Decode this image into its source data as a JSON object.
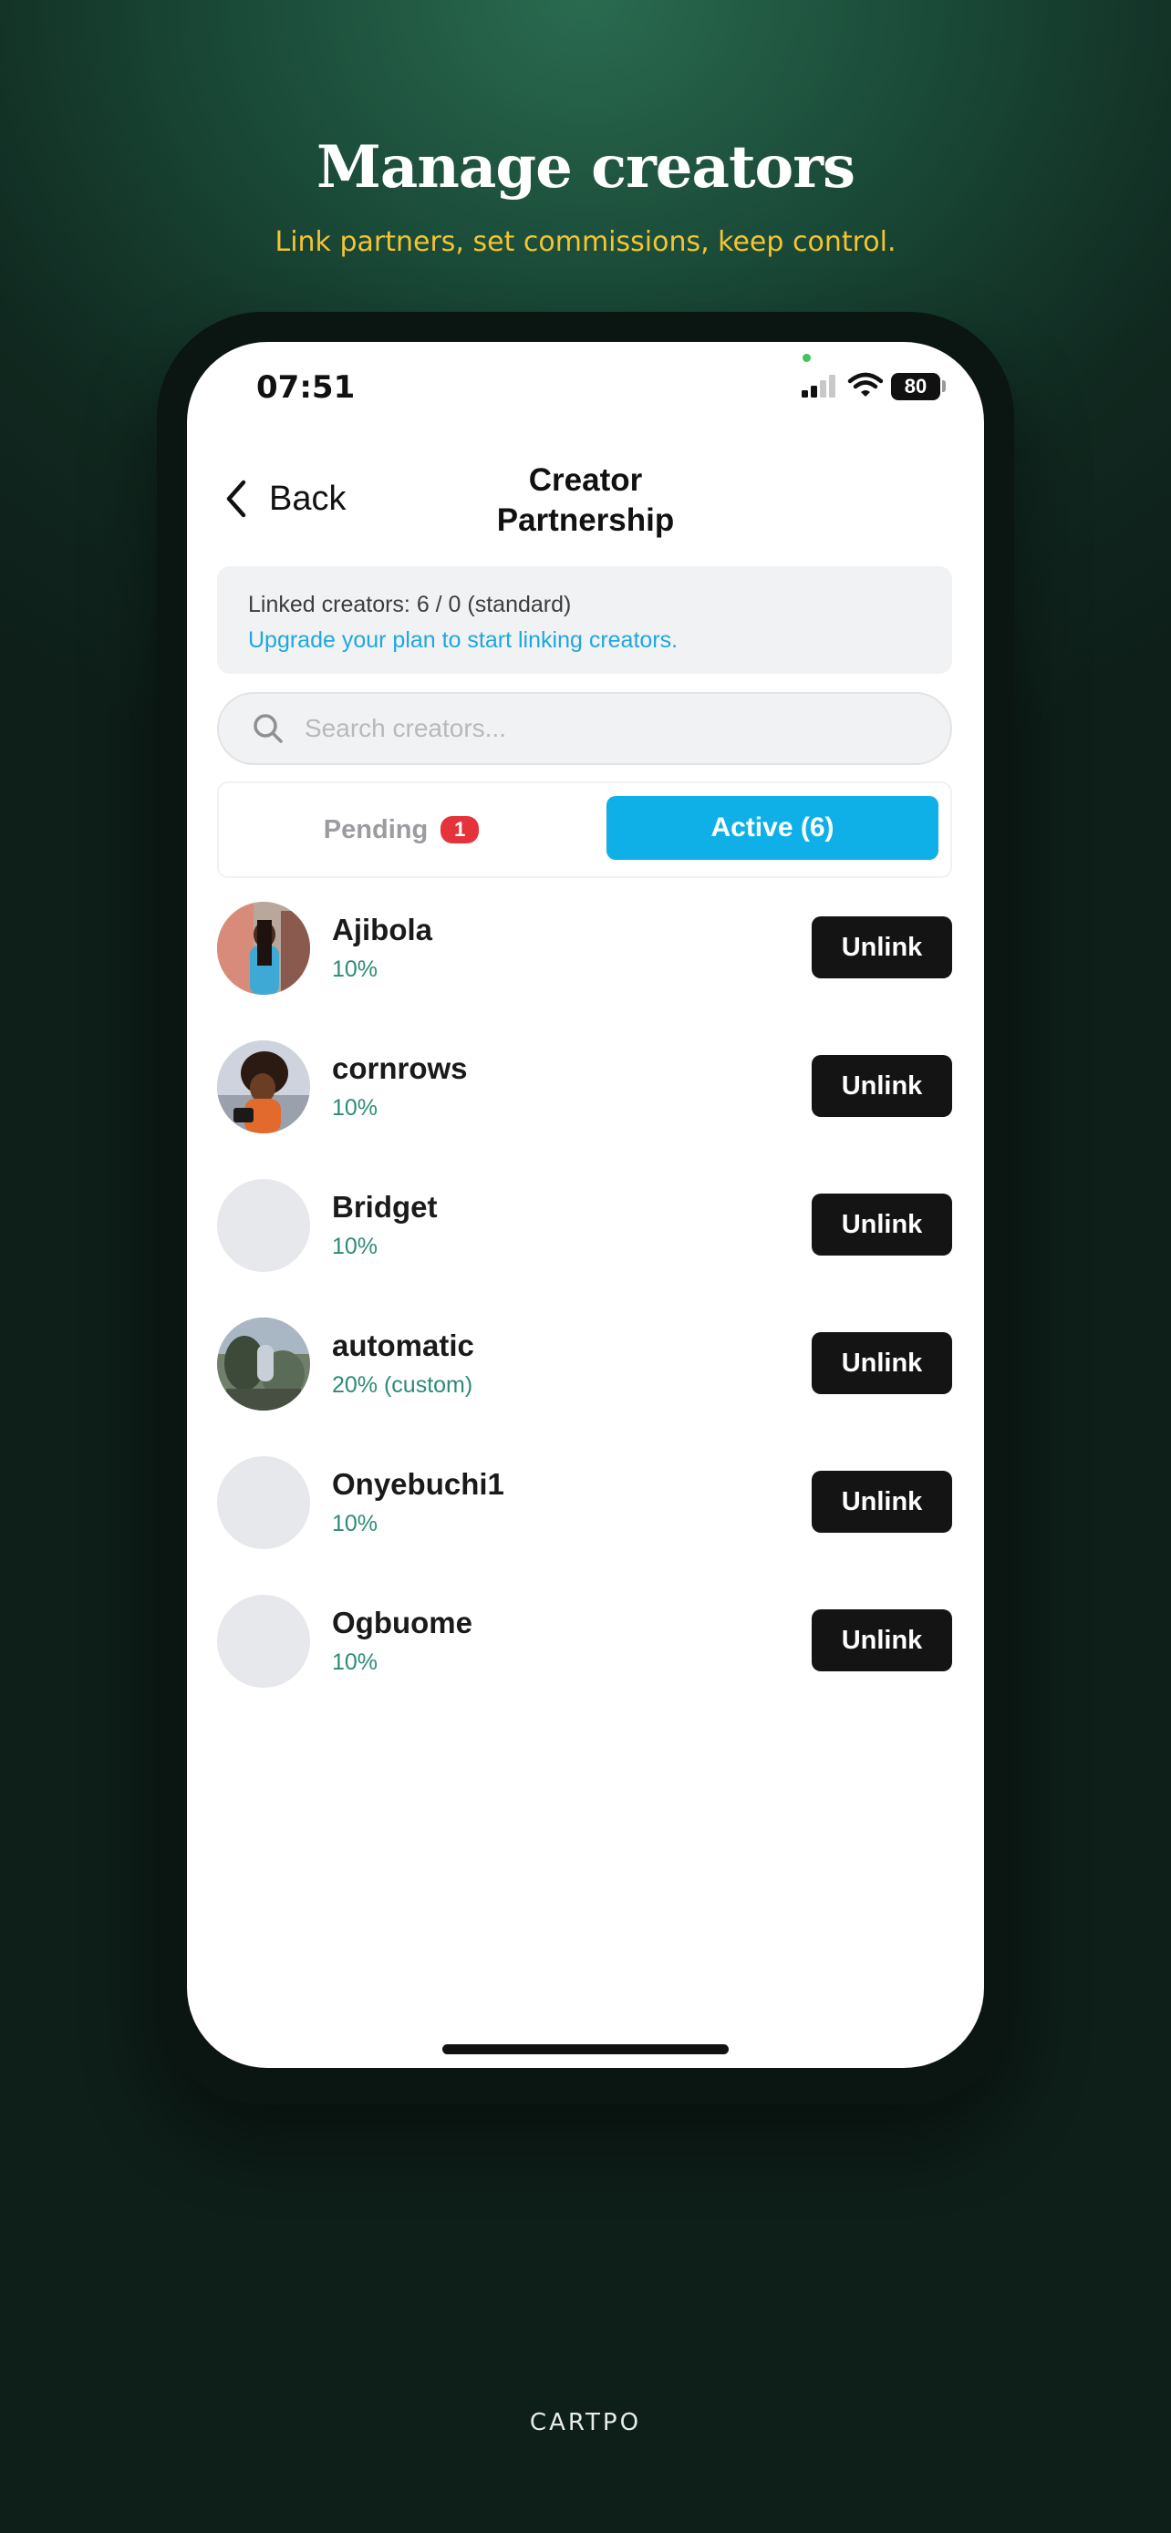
{
  "marketing": {
    "headline": "Manage creators",
    "subline": "Link partners, set commissions, keep control.",
    "brand": "CARTPO"
  },
  "status_bar": {
    "time": "07:51",
    "battery": "80"
  },
  "nav": {
    "back_label": "Back",
    "title": "Creator\nPartnership"
  },
  "info": {
    "linked_text": "Linked creators: 6 / 0 (standard)",
    "upgrade_text": "Upgrade your plan to start linking creators."
  },
  "search": {
    "placeholder": "Search creators..."
  },
  "tabs": {
    "pending_label": "Pending",
    "pending_count": "1",
    "active_label": "Active (6)"
  },
  "creators": [
    {
      "name": "Ajibola",
      "rate": "10%",
      "action": "Unlink",
      "avatar": "photo"
    },
    {
      "name": "cornrows",
      "rate": "10%",
      "action": "Unlink",
      "avatar": "photo"
    },
    {
      "name": "Bridget",
      "rate": "10%",
      "action": "Unlink",
      "avatar": "placeholder"
    },
    {
      "name": "automatic",
      "rate": "20% (custom)",
      "action": "Unlink",
      "avatar": "photo"
    },
    {
      "name": "Onyebuchi1",
      "rate": "10%",
      "action": "Unlink",
      "avatar": "placeholder"
    },
    {
      "name": "Ogbuome",
      "rate": "10%",
      "action": "Unlink",
      "avatar": "placeholder"
    }
  ],
  "colors": {
    "accent": "#0fb0e8",
    "badge": "#e5333b",
    "rate_text": "#2f8a78",
    "link_text": "#1fa7e0",
    "headline_sub": "#f4c431"
  }
}
